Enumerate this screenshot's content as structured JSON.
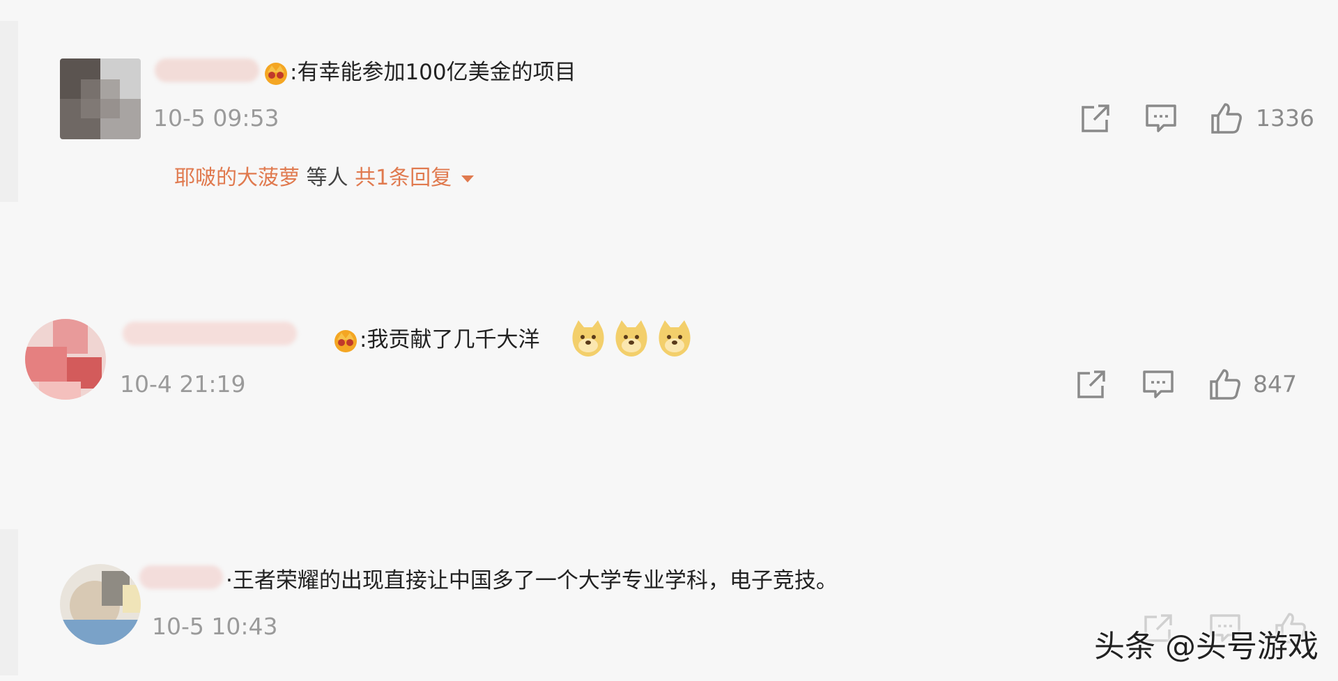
{
  "comments": [
    {
      "text": ":有幸能参加100亿美金的项目",
      "time": "10-5 09:53",
      "likes": "1336",
      "replies": {
        "user": "耶啵的大菠萝",
        "middle": " 等人 ",
        "total": "共1条回复"
      }
    },
    {
      "text": ":我贡献了几千大洋",
      "time": "10-4 21:19",
      "likes": "847"
    },
    {
      "text": "·王者荣耀的出现直接让中国多了一个大学专业学科，电子竞技。",
      "time": "10-5 10:43",
      "likes": ""
    }
  ],
  "watermark": "头条 @头号游戏",
  "icons": {
    "share": "share-icon",
    "comment": "comment-icon",
    "like": "thumbs-up-icon",
    "badge": "vip-badge-icon",
    "emoji": "doge-emoji"
  },
  "colors": {
    "background": "#f7f7f7",
    "accent": "#e07a4f",
    "time": "#9a9a9a",
    "icon": "#8a8a8a"
  }
}
